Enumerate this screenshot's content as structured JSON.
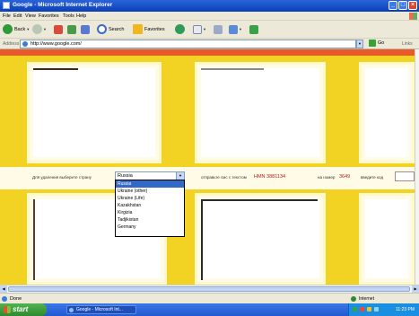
{
  "window": {
    "title": "Google - Microsoft Internet Explorer"
  },
  "menu": [
    "File",
    "Edit",
    "View",
    "Favorites",
    "Tools",
    "Help"
  ],
  "toolbar": {
    "back_label": "Back",
    "search_label": "Search",
    "favorites_label": "Favorites"
  },
  "address": {
    "label": "Address",
    "url": "http://www.google.com/",
    "go_label": "Go",
    "links_label": "Links"
  },
  "form": {
    "country_prompt": "Для удаления выберите страну",
    "country_selected": "Russia",
    "send_text": "отправьте смс с текстом",
    "sms_code": "HMN 3881134",
    "number_label": "на номер",
    "number": "3649",
    "enter_code_label": "введите код"
  },
  "dropdown_options": [
    "Russia",
    "Ukraine (other)",
    "Ukraine (Life)",
    "Kazakhstan",
    "Kirgizia",
    "Tadjikistan",
    "Germany"
  ],
  "status": {
    "text": "Done",
    "zone": "Internet"
  },
  "taskbar": {
    "start_label": "start",
    "window_label": "Google - Microsoft Int...",
    "clock": "11:23 PM"
  },
  "colors": {
    "page_bg": "#f2d222",
    "accent_red": "#b02020",
    "xp_blue": "#2358cf",
    "start_green": "#2f8a2f"
  }
}
